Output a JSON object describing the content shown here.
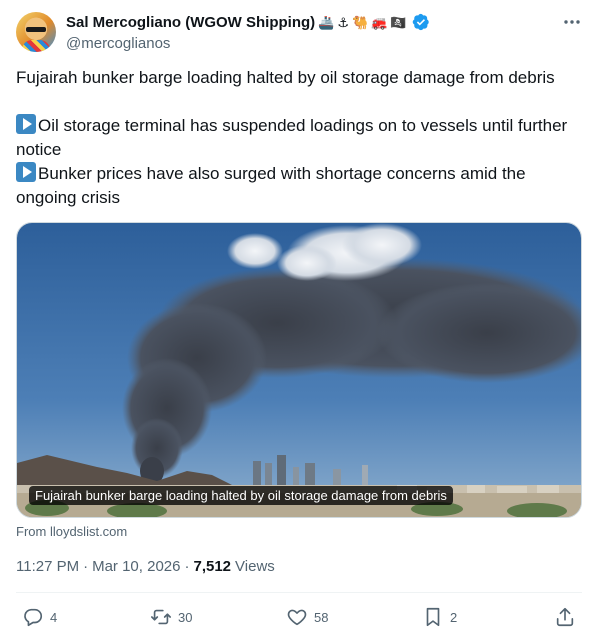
{
  "author": {
    "display_name": "Sal Mercogliano (WGOW Shipping)",
    "handle": "@mercoglianos",
    "name_emojis": [
      "🚢",
      "⚓",
      "🐫",
      "🚒",
      "🏴‍☠️"
    ]
  },
  "tweet": {
    "headline": "Fujairah bunker barge loading halted by oil storage damage from debris",
    "bullets": [
      "Oil storage terminal has suspended loadings on to vessels until further notice",
      "Bunker prices have also surged with shortage concerns amid the ongoing crisis"
    ]
  },
  "card": {
    "caption": "Fujairah bunker barge loading halted by oil storage damage from debris",
    "source": "From lloydslist.com"
  },
  "meta": {
    "time": "11:27 PM",
    "date": "Mar 10, 2026",
    "separator": "·",
    "views_count": "7,512",
    "views_label": "Views"
  },
  "actions": {
    "replies": "4",
    "reposts": "30",
    "likes": "58",
    "bookmarks": "2"
  },
  "colors": {
    "accent": "#1d9bf0",
    "text": "#0f1419",
    "muted": "#536471"
  }
}
